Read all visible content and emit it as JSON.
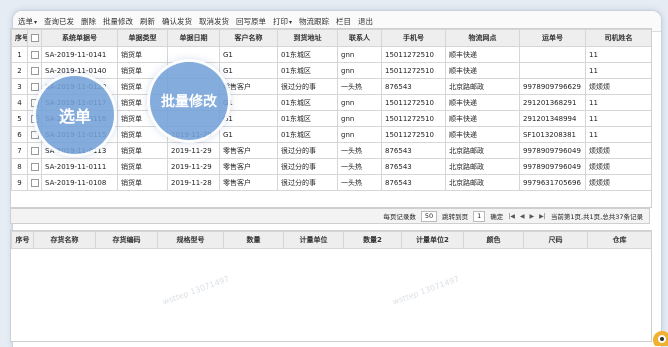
{
  "toolbar": {
    "items": [
      "选单",
      "查询已发",
      "删除",
      "批量修改",
      "刷新",
      "确认发货",
      "取消发货",
      "回写原单",
      "打印",
      "物流跟踪",
      "栏目",
      "退出"
    ]
  },
  "main_grid": {
    "headers": [
      "序号",
      "",
      "系统单据号",
      "单据类型",
      "单据日期",
      "客户名称",
      "到货地址",
      "联系人",
      "手机号",
      "物流网点",
      "运单号",
      "司机姓名"
    ],
    "rows": [
      [
        "1",
        "SA-2019-11-0141",
        "销货单",
        "",
        "G1",
        "01东城区",
        "gnn",
        "15011272510",
        "顺丰快递",
        "",
        "11"
      ],
      [
        "2",
        "SA-2019-11-0140",
        "销货单",
        "",
        "G1",
        "01东城区",
        "gnn",
        "15011272510",
        "顺丰快递",
        "",
        "11"
      ],
      [
        "3",
        "SA-2019-11-0120",
        "销货单",
        "",
        "零售客户",
        "很过分的事",
        "一头热",
        "876543",
        "北京路邮政",
        "9978909796629",
        "烦烦烦"
      ],
      [
        "4",
        "SA-2019-11-0117",
        "销货单",
        "",
        "G1",
        "01东城区",
        "gnn",
        "15011272510",
        "顺丰快递",
        "291201368291",
        "11"
      ],
      [
        "5",
        "SA-2019-11-0116",
        "销货单",
        "",
        "G1",
        "01东城区",
        "gnn",
        "15011272510",
        "顺丰快递",
        "291201348994",
        "11"
      ],
      [
        "6",
        "SA-2019-11-0115",
        "销货单",
        "2019-11-29",
        "G1",
        "01东城区",
        "gnn",
        "15011272510",
        "顺丰快递",
        "SF1013208381",
        "11"
      ],
      [
        "7",
        "SA-2019-11-0113",
        "销货单",
        "2019-11-29",
        "零售客户",
        "很过分的事",
        "一头热",
        "876543",
        "北京路邮政",
        "9978909796049",
        "烦烦烦"
      ],
      [
        "8",
        "SA-2019-11-0111",
        "销货单",
        "2019-11-29",
        "零售客户",
        "很过分的事",
        "一头热",
        "876543",
        "北京路邮政",
        "9978909796049",
        "烦烦烦"
      ],
      [
        "9",
        "SA-2019-11-0108",
        "销货单",
        "2019-11-28",
        "零售客户",
        "很过分的事",
        "一头热",
        "876543",
        "北京路邮政",
        "9979631705696",
        "烦烦烦"
      ]
    ]
  },
  "pager": {
    "per_page_label": "每页记录数",
    "per_page": "50",
    "jump_label": "跳转到页",
    "page_input": "1",
    "confirm": "确定",
    "status": "当前第1页,共1页,总共37条记录"
  },
  "detail_grid": {
    "headers": [
      "序号",
      "存货名称",
      "存货编码",
      "规格型号",
      "数量",
      "计量单位",
      "数量2",
      "计量单位2",
      "颜色",
      "尺码",
      "仓库"
    ]
  },
  "overlay": {
    "bubble_select": "选单",
    "bubble_batch": "批量修改",
    "watermark": "wsttep 13071497"
  },
  "colors": {
    "bubble": "#73a0d7",
    "frame_bg": "#e6ecf4"
  }
}
